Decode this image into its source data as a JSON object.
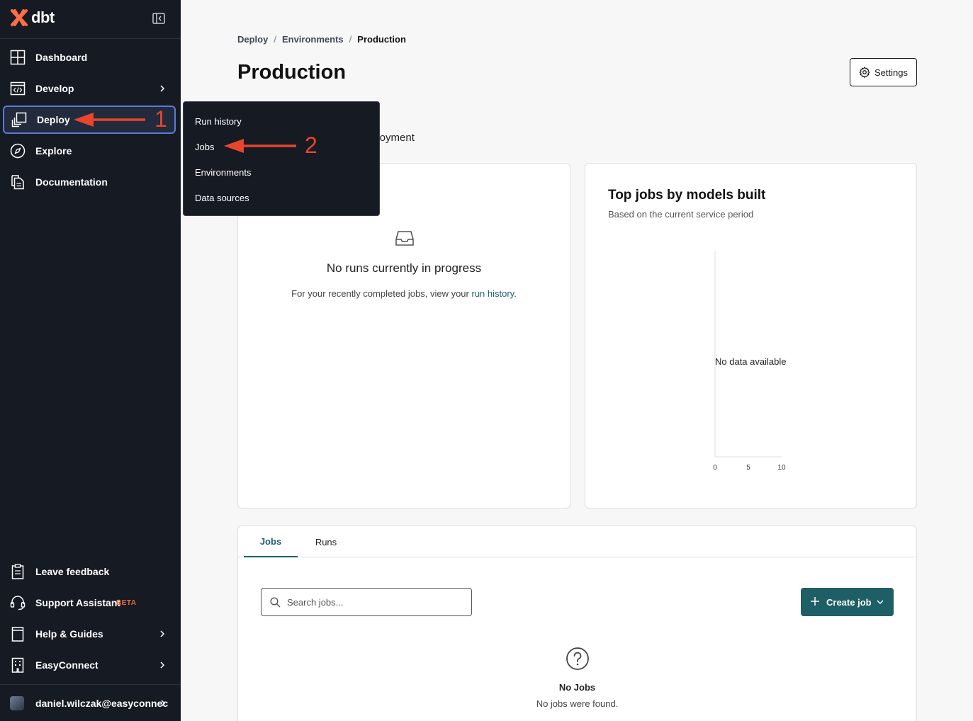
{
  "brand": {
    "name": "dbt"
  },
  "sidebar": {
    "items": [
      {
        "label": "Dashboard",
        "icon": "dashboard-icon"
      },
      {
        "label": "Develop",
        "icon": "code-window-icon"
      },
      {
        "label": "Deploy",
        "icon": "deploy-icon"
      },
      {
        "label": "Explore",
        "icon": "compass-icon"
      },
      {
        "label": "Documentation",
        "icon": "documents-icon"
      }
    ],
    "bottom_items": [
      {
        "label": "Leave feedback",
        "icon": "clipboard-icon"
      },
      {
        "label": "Support Assistant",
        "badge": "BETA",
        "icon": "headset-icon"
      },
      {
        "label": "Help & Guides",
        "icon": "book-icon"
      },
      {
        "label": "EasyConnect",
        "icon": "building-icon"
      }
    ],
    "user": {
      "email": "daniel.wilczak@easyconnec"
    }
  },
  "flyout": {
    "items": [
      "Run history",
      "Jobs",
      "Environments",
      "Data sources"
    ]
  },
  "annotations": {
    "step1": "1",
    "step2": "2"
  },
  "breadcrumb": {
    "items": [
      "Deploy",
      "Environments",
      "Production"
    ]
  },
  "page": {
    "title": "Production",
    "settings_label": "Settings",
    "deployment_type_fragment": "ployment"
  },
  "runs_card": {
    "title": "No runs currently in progress",
    "subtitle_prefix": "For your recently completed jobs, view your ",
    "subtitle_link": "run history",
    "subtitle_suffix": "."
  },
  "top_jobs": {
    "title": "Top jobs by models built",
    "subtitle": "Based on the current service period"
  },
  "chart_data": {
    "type": "bar",
    "title": "Top jobs by models built",
    "subtitle": "Based on the current service period",
    "categories": [],
    "values": [],
    "xlim": [
      0,
      10
    ],
    "x_ticks": [
      "0",
      "5",
      "10"
    ],
    "empty_message": "No data available",
    "grid": false
  },
  "jobs_panel": {
    "tabs": [
      "Jobs",
      "Runs"
    ],
    "active_tab": "Jobs",
    "search_placeholder": "Search jobs...",
    "create_label": "Create job",
    "empty_title": "No Jobs",
    "empty_subtitle": "No jobs were found."
  },
  "colors": {
    "sidebar_bg": "#161a23",
    "accent": "#1e5f74",
    "button": "#1e5f66",
    "annotation": "#e8452c"
  }
}
